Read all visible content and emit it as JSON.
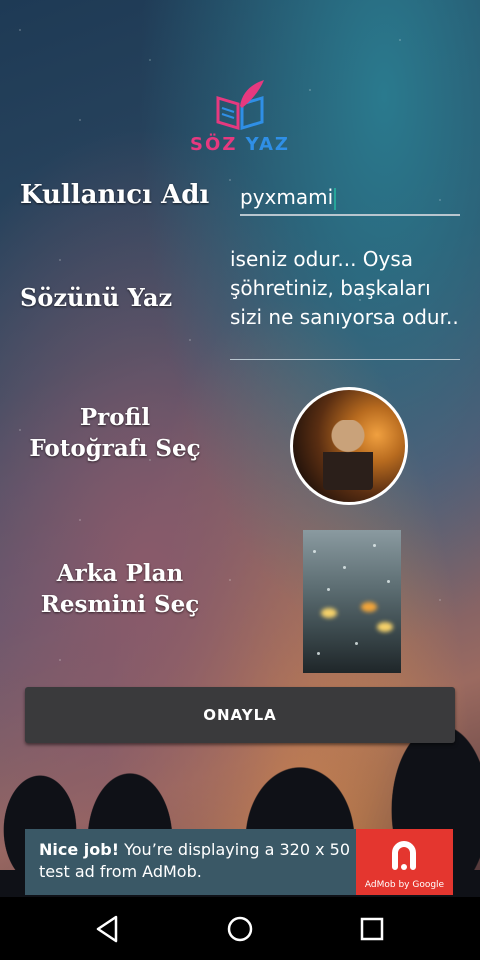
{
  "app": {
    "logo_text_left": "SÖZ",
    "logo_text_right": "YAZ"
  },
  "form": {
    "username_label": "Kullanıcı Adı",
    "username_value": "pyxmami",
    "quote_label": "Sözünü Yaz",
    "quote_value": "iseniz odur... Oysa şöhretiniz, başkaları sizi ne sanıyorsa odur..",
    "profile_photo_label": "Profil Fotoğrafı Seç",
    "background_label": "Arka Plan Resmini Seç",
    "confirm_label": "ONAYLA"
  },
  "ad": {
    "headline": "Nice job!",
    "body": "You’re displaying a 320 x 50 test ad from AdMob.",
    "brand": "AdMob by Google"
  },
  "colors": {
    "logo_pink": "#e6397f",
    "logo_blue": "#2f8fe6",
    "button_bg": "#3a3a3c",
    "ad_bg": "#3a5866",
    "ad_logo_bg": "#e4362f",
    "accent_caret": "#26a69a"
  },
  "icons": {
    "logo": "book-feather-icon",
    "nav_back": "triangle-back-icon",
    "nav_home": "circle-home-icon",
    "nav_recent": "square-recents-icon"
  }
}
